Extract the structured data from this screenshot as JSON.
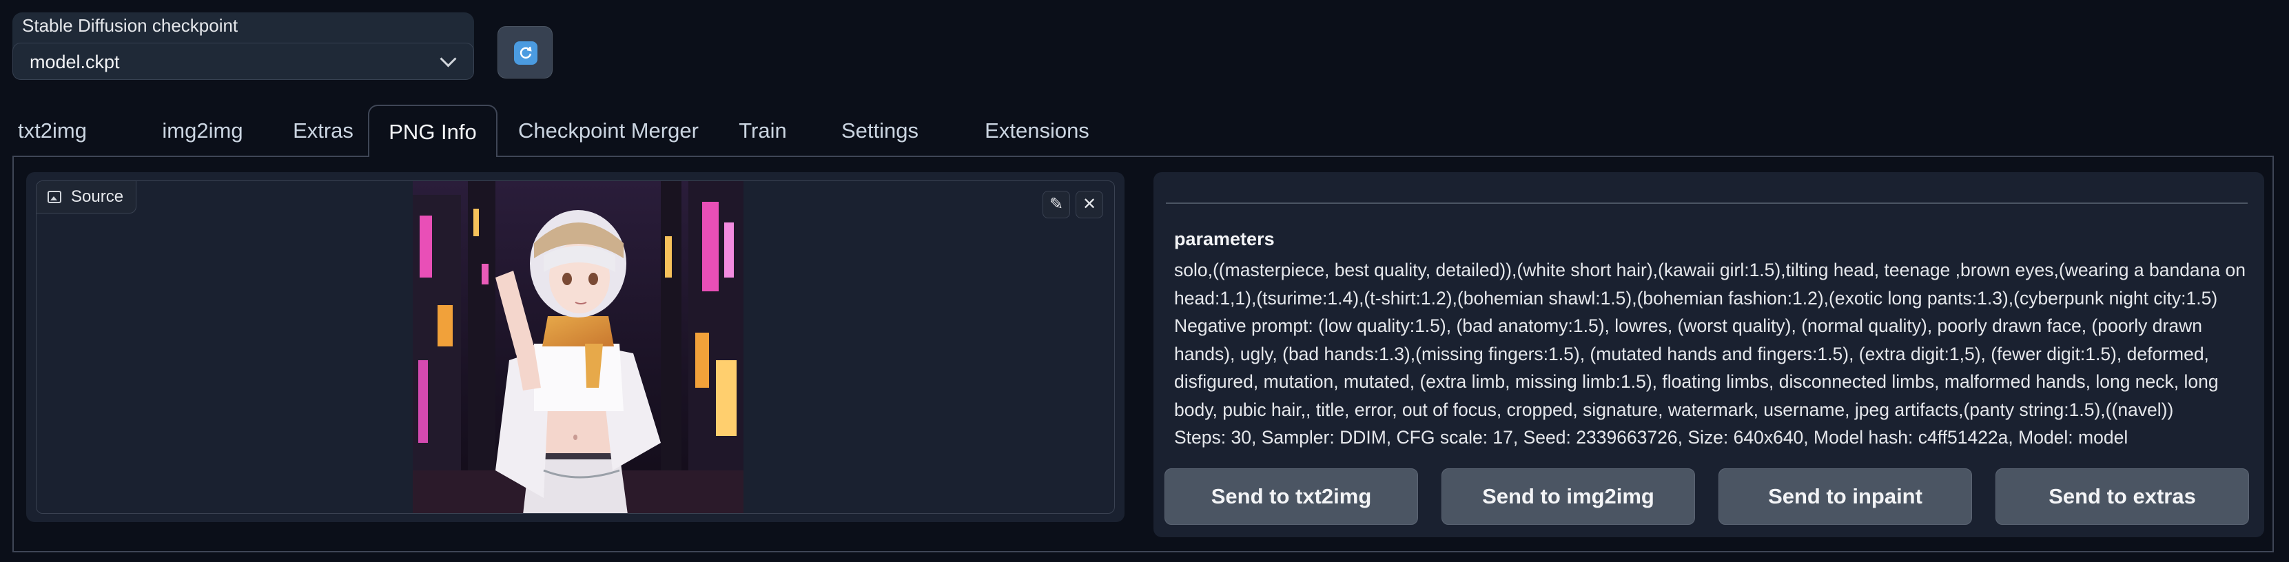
{
  "checkpoint": {
    "label": "Stable Diffusion checkpoint",
    "value": "model.ckpt",
    "refresh_icon": "refresh-icon"
  },
  "tabs": [
    {
      "label": "txt2img"
    },
    {
      "label": "img2img"
    },
    {
      "label": "Extras"
    },
    {
      "label": "PNG Info",
      "active": true
    },
    {
      "label": "Checkpoint Merger"
    },
    {
      "label": "Train"
    },
    {
      "label": "Settings"
    },
    {
      "label": "Extensions"
    }
  ],
  "source": {
    "badge_label": "Source",
    "badge_icon": "image-icon",
    "edit_icon": "pencil-icon",
    "close_icon": "close-icon"
  },
  "info": {
    "title": "parameters",
    "positive_prompt": "solo,((masterpiece, best quality, detailed)),(white short hair),(kawaii girl:1.5),tilting head, teenage ,brown eyes,(wearing a bandana on head:1,1),(tsurime:1.4),(t-shirt:1.2),(bohemian shawl:1.5),(bohemian fashion:1.2),(exotic long pants:1.3),(cyberpunk night city:1.5)",
    "negative_prompt": "Negative prompt: (low quality:1.5), (bad anatomy:1.5), lowres, (worst quality), (normal quality), poorly drawn face, (poorly drawn hands), ugly, (bad hands:1.3),(missing fingers:1.5), (mutated hands and fingers:1.5), (extra digit:1,5), (fewer digit:1.5), deformed, disfigured, mutation, mutated, (extra limb, missing limb:1.5), floating limbs, disconnected limbs, malformed hands, long neck, long body, pubic hair,, title, error, out of focus, cropped, signature, watermark, username, jpeg artifacts,(panty string:1.5),((navel))",
    "settings_line": "Steps: 30, Sampler: DDIM, CFG scale: 17, Seed: 2339663726, Size: 640x640, Model hash: c4ff51422a, Model: model"
  },
  "buttons": {
    "send_txt2img": "Send to txt2img",
    "send_img2img": "Send to img2img",
    "send_inpaint": "Send to inpaint",
    "send_extras": "Send to extras"
  },
  "colors": {
    "background": "#0b0f19",
    "panel": "#1a2130",
    "button": "#4b5563",
    "accent": "#4b9be0"
  }
}
